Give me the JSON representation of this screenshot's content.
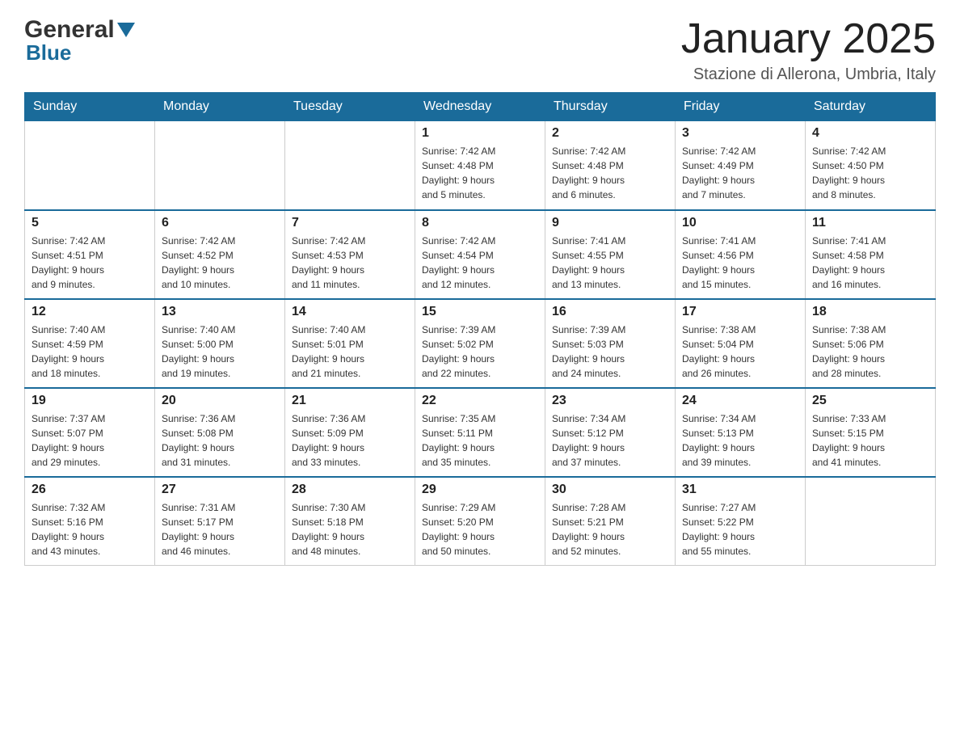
{
  "header": {
    "logo_general": "General",
    "logo_blue": "Blue",
    "month_title": "January 2025",
    "location": "Stazione di Allerona, Umbria, Italy"
  },
  "days_of_week": [
    "Sunday",
    "Monday",
    "Tuesday",
    "Wednesday",
    "Thursday",
    "Friday",
    "Saturday"
  ],
  "weeks": [
    [
      {
        "day": "",
        "info": ""
      },
      {
        "day": "",
        "info": ""
      },
      {
        "day": "",
        "info": ""
      },
      {
        "day": "1",
        "info": "Sunrise: 7:42 AM\nSunset: 4:48 PM\nDaylight: 9 hours\nand 5 minutes."
      },
      {
        "day": "2",
        "info": "Sunrise: 7:42 AM\nSunset: 4:48 PM\nDaylight: 9 hours\nand 6 minutes."
      },
      {
        "day": "3",
        "info": "Sunrise: 7:42 AM\nSunset: 4:49 PM\nDaylight: 9 hours\nand 7 minutes."
      },
      {
        "day": "4",
        "info": "Sunrise: 7:42 AM\nSunset: 4:50 PM\nDaylight: 9 hours\nand 8 minutes."
      }
    ],
    [
      {
        "day": "5",
        "info": "Sunrise: 7:42 AM\nSunset: 4:51 PM\nDaylight: 9 hours\nand 9 minutes."
      },
      {
        "day": "6",
        "info": "Sunrise: 7:42 AM\nSunset: 4:52 PM\nDaylight: 9 hours\nand 10 minutes."
      },
      {
        "day": "7",
        "info": "Sunrise: 7:42 AM\nSunset: 4:53 PM\nDaylight: 9 hours\nand 11 minutes."
      },
      {
        "day": "8",
        "info": "Sunrise: 7:42 AM\nSunset: 4:54 PM\nDaylight: 9 hours\nand 12 minutes."
      },
      {
        "day": "9",
        "info": "Sunrise: 7:41 AM\nSunset: 4:55 PM\nDaylight: 9 hours\nand 13 minutes."
      },
      {
        "day": "10",
        "info": "Sunrise: 7:41 AM\nSunset: 4:56 PM\nDaylight: 9 hours\nand 15 minutes."
      },
      {
        "day": "11",
        "info": "Sunrise: 7:41 AM\nSunset: 4:58 PM\nDaylight: 9 hours\nand 16 minutes."
      }
    ],
    [
      {
        "day": "12",
        "info": "Sunrise: 7:40 AM\nSunset: 4:59 PM\nDaylight: 9 hours\nand 18 minutes."
      },
      {
        "day": "13",
        "info": "Sunrise: 7:40 AM\nSunset: 5:00 PM\nDaylight: 9 hours\nand 19 minutes."
      },
      {
        "day": "14",
        "info": "Sunrise: 7:40 AM\nSunset: 5:01 PM\nDaylight: 9 hours\nand 21 minutes."
      },
      {
        "day": "15",
        "info": "Sunrise: 7:39 AM\nSunset: 5:02 PM\nDaylight: 9 hours\nand 22 minutes."
      },
      {
        "day": "16",
        "info": "Sunrise: 7:39 AM\nSunset: 5:03 PM\nDaylight: 9 hours\nand 24 minutes."
      },
      {
        "day": "17",
        "info": "Sunrise: 7:38 AM\nSunset: 5:04 PM\nDaylight: 9 hours\nand 26 minutes."
      },
      {
        "day": "18",
        "info": "Sunrise: 7:38 AM\nSunset: 5:06 PM\nDaylight: 9 hours\nand 28 minutes."
      }
    ],
    [
      {
        "day": "19",
        "info": "Sunrise: 7:37 AM\nSunset: 5:07 PM\nDaylight: 9 hours\nand 29 minutes."
      },
      {
        "day": "20",
        "info": "Sunrise: 7:36 AM\nSunset: 5:08 PM\nDaylight: 9 hours\nand 31 minutes."
      },
      {
        "day": "21",
        "info": "Sunrise: 7:36 AM\nSunset: 5:09 PM\nDaylight: 9 hours\nand 33 minutes."
      },
      {
        "day": "22",
        "info": "Sunrise: 7:35 AM\nSunset: 5:11 PM\nDaylight: 9 hours\nand 35 minutes."
      },
      {
        "day": "23",
        "info": "Sunrise: 7:34 AM\nSunset: 5:12 PM\nDaylight: 9 hours\nand 37 minutes."
      },
      {
        "day": "24",
        "info": "Sunrise: 7:34 AM\nSunset: 5:13 PM\nDaylight: 9 hours\nand 39 minutes."
      },
      {
        "day": "25",
        "info": "Sunrise: 7:33 AM\nSunset: 5:15 PM\nDaylight: 9 hours\nand 41 minutes."
      }
    ],
    [
      {
        "day": "26",
        "info": "Sunrise: 7:32 AM\nSunset: 5:16 PM\nDaylight: 9 hours\nand 43 minutes."
      },
      {
        "day": "27",
        "info": "Sunrise: 7:31 AM\nSunset: 5:17 PM\nDaylight: 9 hours\nand 46 minutes."
      },
      {
        "day": "28",
        "info": "Sunrise: 7:30 AM\nSunset: 5:18 PM\nDaylight: 9 hours\nand 48 minutes."
      },
      {
        "day": "29",
        "info": "Sunrise: 7:29 AM\nSunset: 5:20 PM\nDaylight: 9 hours\nand 50 minutes."
      },
      {
        "day": "30",
        "info": "Sunrise: 7:28 AM\nSunset: 5:21 PM\nDaylight: 9 hours\nand 52 minutes."
      },
      {
        "day": "31",
        "info": "Sunrise: 7:27 AM\nSunset: 5:22 PM\nDaylight: 9 hours\nand 55 minutes."
      },
      {
        "day": "",
        "info": ""
      }
    ]
  ]
}
